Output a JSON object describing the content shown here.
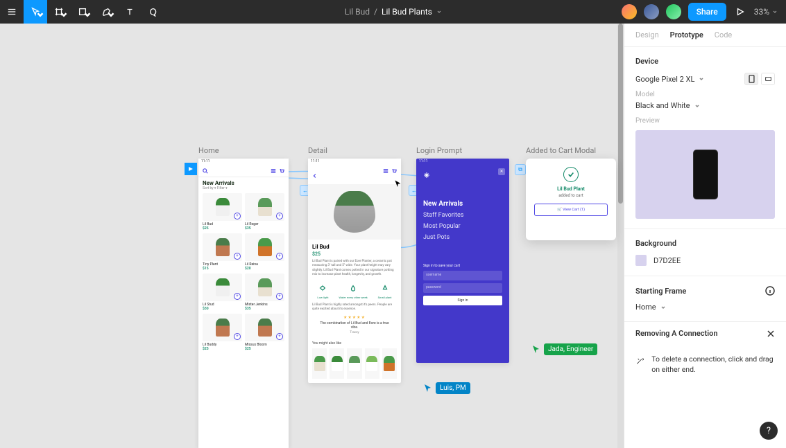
{
  "toolbar": {
    "project": "Lil Bud",
    "file": "Lil Bud Plants",
    "share_label": "Share",
    "zoom": "33%"
  },
  "collaborators": {
    "jada": "Jada, Engineer",
    "luis": "Luis, PM"
  },
  "frames": {
    "home": {
      "label": "Home",
      "title": "New Arrivals",
      "subtitle": "Sort by ▾    Filter ▾",
      "products": [
        {
          "name": "Lil Bud",
          "price": "$25"
        },
        {
          "name": "Lil Roger",
          "price": "$35"
        },
        {
          "name": "Tiny Plant",
          "price": "$15"
        },
        {
          "name": "Lil Reina",
          "price": "$20"
        },
        {
          "name": "Lil Stud",
          "price": "$30"
        },
        {
          "name": "Mister Jenkins",
          "price": "$35"
        },
        {
          "name": "Lil Buddy",
          "price": "$25"
        },
        {
          "name": "Missus Bloom",
          "price": "$25"
        }
      ]
    },
    "detail": {
      "label": "Detail",
      "name": "Lil Bud",
      "price": "$25",
      "desc": "Lil Bud Plant is paired with our Eore Planter, a ceramic pot measuring 3\" tall and 5\" wide. Your plant height may vary slightly. Lil Bud Plant comes potted in our signature potting mix to increase plant health, longevity, and growth.",
      "icons": [
        "Low light",
        "Water every other week",
        "Small plant"
      ],
      "rating_desc": "Lil Bud Plant is highly rated amongst it's peers. People are quite excited about its essence.",
      "review": "The combination of Lil Bud and Eore is a true vibe.",
      "reviewer": "Tracey",
      "ymal": "You might also like"
    },
    "login": {
      "label": "Login Prompt",
      "nav": [
        "New Arrivals",
        "Staff Favorites",
        "Most Popular",
        "Just Pots"
      ],
      "form_label": "Sign in to save your cart",
      "username_ph": "username",
      "password_ph": "password",
      "signin": "Sign in"
    },
    "cart": {
      "label": "Added to Cart Modal",
      "title": "Lil Bud Plant",
      "subtitle": "added to cart",
      "button": "🛒 View Cart (1)"
    }
  },
  "panel": {
    "tabs": [
      "Design",
      "Prototype",
      "Code"
    ],
    "device_title": "Device",
    "device_value": "Google Pixel 2 XL",
    "model_label": "Model",
    "model_value": "Black and White",
    "preview_label": "Preview",
    "background_title": "Background",
    "background_value": "D7D2EE",
    "starting_title": "Starting Frame",
    "starting_value": "Home",
    "tip_title": "Removing A Connection",
    "tip_text": "To delete a connection, click and drag on either end."
  }
}
